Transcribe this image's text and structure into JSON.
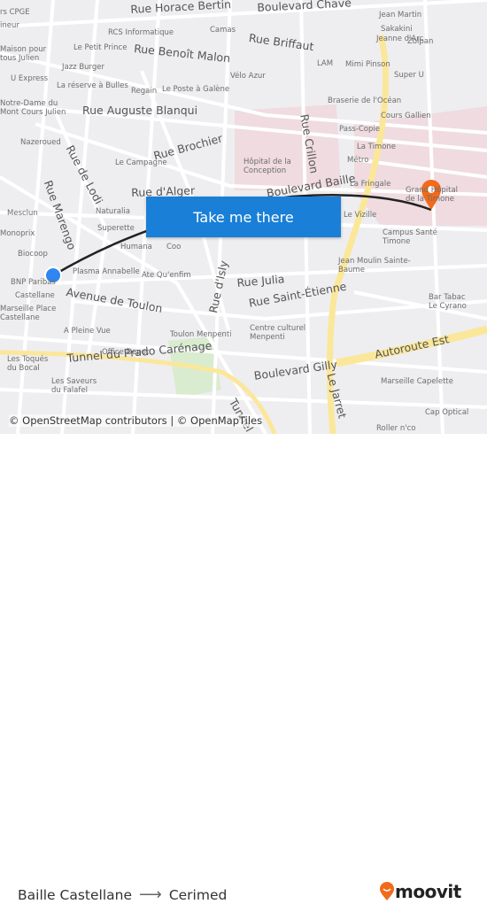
{
  "map": {
    "labels": [
      "Rue Horace Bertin",
      "Boulevard Chave",
      "Jean Martin",
      "Sakakini",
      "Jeanne d'Arc",
      "Zolpan",
      "Mimi Pinson",
      "Super U",
      "Rue Briffaut",
      "RCS Informatique",
      "Camas",
      "Le Petit Prince",
      "Rue Benoît Malon",
      "LAM",
      "Vélo Azur",
      "Jazz Burger",
      "La réserve à Bulles",
      "Regain",
      "Le Poste à Galène",
      "Braserie de l'Océan",
      "Cours Gallien",
      "Rue Auguste Blanqui",
      "Notre-Dame du\nMont Cours Julien",
      "Maison pour\ntous Julien",
      "U Express",
      "rs CPGE",
      "ineur",
      "Pass-Copie",
      "La Timone",
      "Métro",
      "Rue Crillon",
      "Rue Brochier",
      "Nazeroued",
      "Rue de Lodi",
      "Le Campagne",
      "Hôpital de la\nConception",
      "Rue d'Alger",
      "Boulevard Baille",
      "La Fringale",
      "Grand Hôpital\nde la Timone",
      "Rue Marengo",
      "Mesclun",
      "Naturalia",
      "Monoprix",
      "Superette",
      "Le Vizille",
      "Campus Santé\nTimone",
      "Humana",
      "Coo",
      "Biocoop",
      "Jean Moulin Sainte-\nBaume",
      "BNP Paribas",
      "Plasma Annabelle",
      "Ate Qu'enfim",
      "Rue d'Isly",
      "Rue Julia",
      "Rue Saint-Étienne",
      "Castellane",
      "Avenue de Toulon",
      "Bar Tabac\nLe Cyrano",
      "Marseille Place\nCastellane",
      "A Pleine Vue",
      "Toulon Menpenti",
      "Centre culturel\nMenpenti",
      "Autoroute Est",
      "Office Depot",
      "Les Toqués\ndu Bocal",
      "Tunnel du Prado Carénage",
      "Boulevard Gilly",
      "Le Jarret",
      "Marseille Capelette",
      "Les Saveurs\ndu Falafel",
      "Cap Optical",
      "Roller n'co",
      "Tunnel"
    ],
    "origin_marker_color": "#2f86f0",
    "destination_marker_color": "#f26a1b",
    "route_color": "#222222",
    "hospital_area_color": "#efdbe0",
    "highway_color": "#fbe79a"
  },
  "cta": {
    "label": "Take me there",
    "color": "#1a7fd6"
  },
  "attribution": "© OpenStreetMap contributors | © OpenMapTiles",
  "footer": {
    "origin": "Baille Castellane",
    "arrow": "⟶",
    "destination": "Cerimed",
    "brand": "moovit",
    "brand_color": "#f26a1b"
  }
}
